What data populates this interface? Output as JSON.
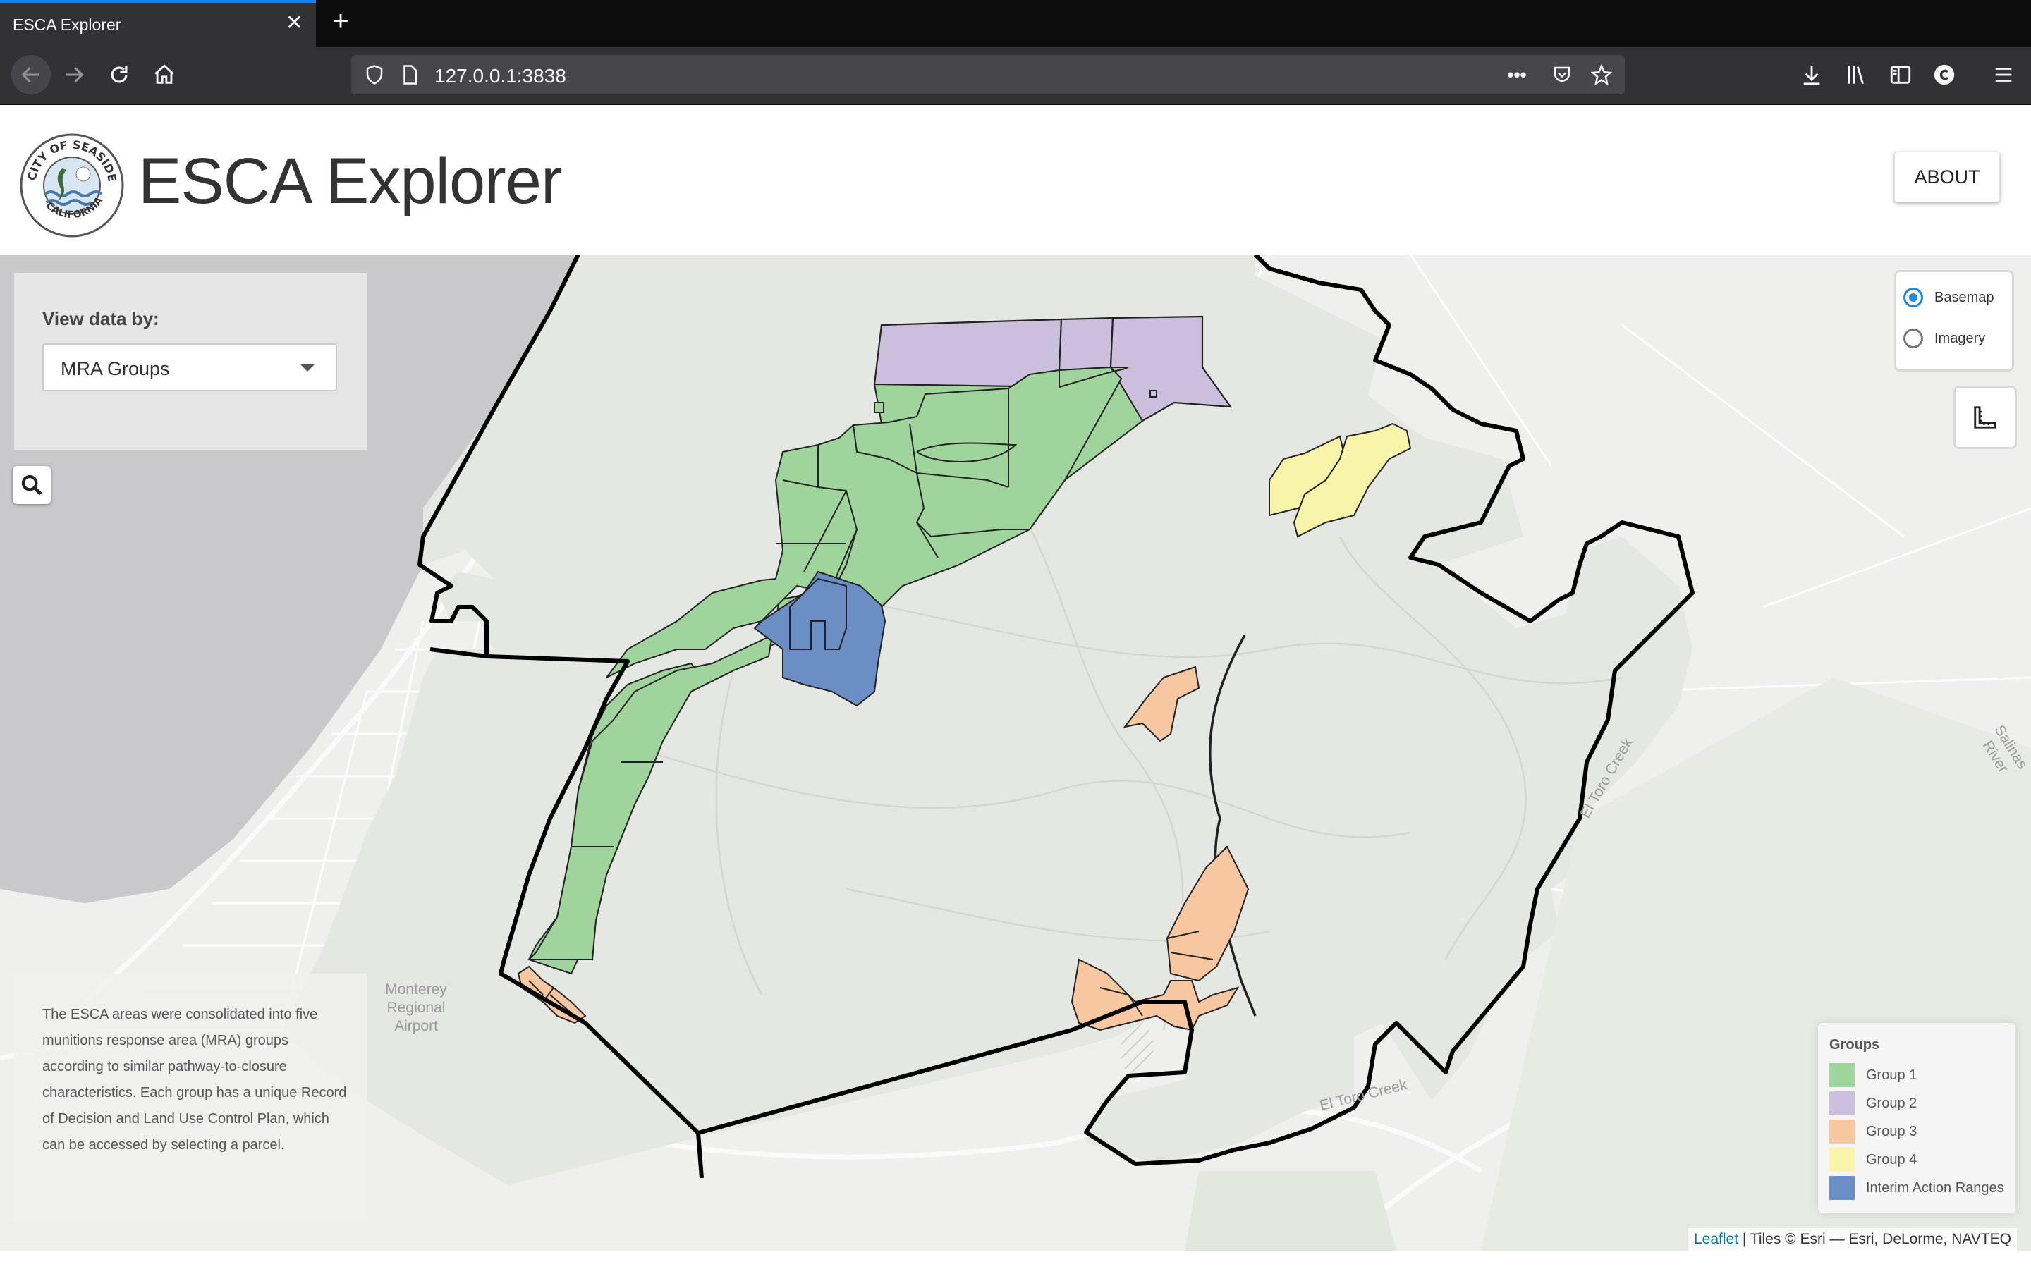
{
  "browser": {
    "tab_title": "ESCA Explorer",
    "tab_close": "✕",
    "new_tab": "+",
    "url": "127.0.0.1:3838",
    "page_actions": "•••"
  },
  "header": {
    "title": "ESCA Explorer",
    "about_label": "ABOUT",
    "seal_text_top": "CITY OF SEASIDE",
    "seal_text_bottom": "CALIFORNIA"
  },
  "controls": {
    "view_label": "View data by:",
    "select_value": "MRA Groups"
  },
  "layers": {
    "options": [
      {
        "label": "Basemap",
        "selected": true
      },
      {
        "label": "Imagery",
        "selected": false
      }
    ]
  },
  "info": {
    "text": "The ESCA areas were consolidated into five munitions response area (MRA) groups according to similar pathway-to-closure characteristics. Each group has a unique Record of Decision and Land Use Control Plan, which can be accessed by selecting a parcel."
  },
  "legend": {
    "title": "Groups",
    "items": [
      {
        "label": "Group 1",
        "color": "#9fd59c"
      },
      {
        "label": "Group 2",
        "color": "#cbbfdd"
      },
      {
        "label": "Group 3",
        "color": "#f7c7a1"
      },
      {
        "label": "Group 4",
        "color": "#f8f4aa"
      },
      {
        "label": "Interim Action Ranges",
        "color": "#6b8fc4"
      }
    ]
  },
  "map_labels": {
    "airport": "Monterey Regional Airport",
    "creek": "El Toro Creek",
    "creek_upper": "El Toro Creek",
    "river": "Salinas River"
  },
  "attribution": {
    "link": "Leaflet",
    "text": " | Tiles © Esri — Esri, DeLorme, NAVTEQ"
  }
}
